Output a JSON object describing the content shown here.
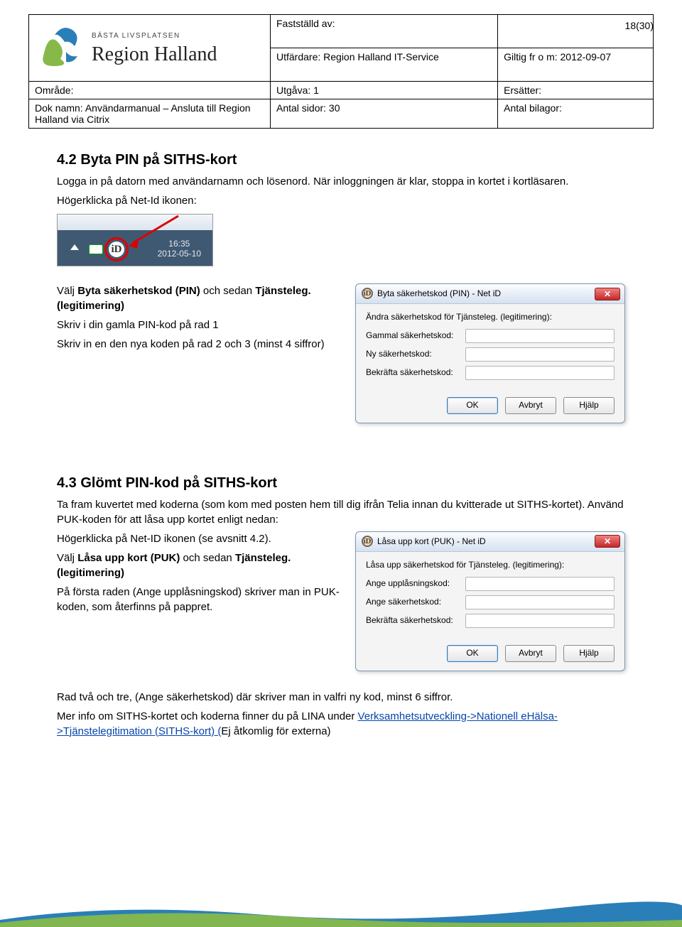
{
  "page_number": "18(30)",
  "header": {
    "logo_tagline": "BÄSTA LIVSPLATSEN",
    "logo_name": "Region Halland",
    "row1_col2_label": "Fastställd av:",
    "row2_col2": "Utfärdare: Region Halland IT-Service",
    "row2_col3": "Giltig fr o m: 2012-09-07",
    "row3_col1": "Område:",
    "row3_col2": "Utgåva: 1",
    "row3_col3": "Ersätter:",
    "row4_col1": "Dok namn: Användarmanual – Ansluta till Region Halland via Citrix",
    "row4_col2": "Antal sidor: 30",
    "row4_col3": "Antal bilagor:"
  },
  "s42": {
    "heading": "4.2 Byta PIN på SITHS-kort",
    "p1": "Logga in på datorn med användarnamn och lösenord. När inloggningen är klar, stoppa in kortet i kortläsaren.",
    "p2": "Högerklicka på Net-Id ikonen:",
    "p3_pre": "Välj ",
    "p3_b1": "Byta säkerhetskod (PIN)",
    "p3_mid": " och sedan ",
    "p3_b2": "Tjänsteleg. (legitimering)",
    "p4": "Skriv i din gamla PIN-kod på rad 1",
    "p5": "Skriv in en den nya koden på rad 2 och 3 (minst 4 siffror)"
  },
  "tray": {
    "netid_glyph": "iD",
    "time": "16:35",
    "date": "2012-05-10"
  },
  "dlg1": {
    "title": "Byta säkerhetskod (PIN) - Net iD",
    "subtitle": "Ändra säkerhetskod för Tjänsteleg. (legitimering):",
    "l1": "Gammal säkerhetskod:",
    "l2": "Ny säkerhetskod:",
    "l3": "Bekräfta säkerhetskod:",
    "ok": "OK",
    "cancel": "Avbryt",
    "help": "Hjälp"
  },
  "s43": {
    "heading": "4.3 Glömt PIN-kod på SITHS-kort",
    "p1": "Ta fram kuvertet med koderna (som kom med posten hem till dig ifrån Telia innan du kvitterade ut SITHS-kortet). Använd PUK-koden för att låsa upp kortet enligt nedan:",
    "p2": "Högerklicka på Net-ID ikonen (se avsnitt 4.2).",
    "p3_pre": "Välj ",
    "p3_b1": "Låsa upp kort (PUK)",
    "p3_mid": " och sedan ",
    "p3_b2": "Tjänsteleg. (legitimering)",
    "p4": "På första raden (Ange upplåsningskod) skriver man in PUK-koden, som återfinns på pappret.",
    "p5": "Rad två och tre, (Ange säkerhetskod) där skriver man in valfri ny kod, minst 6 siffror.",
    "p6_pre": "Mer info om SITHS-kortet och koderna finner du på LINA under ",
    "p6_link": "Verksamhetsutveckling->Nationell eHälsa->Tjänstelegitimation (SITHS-kort) (",
    "p6_post": "Ej åtkomlig för externa)"
  },
  "dlg2": {
    "title": "Låsa upp kort (PUK) - Net iD",
    "subtitle": "Låsa upp säkerhetskod för Tjänsteleg. (legitimering):",
    "l1": "Ange upplåsningskod:",
    "l2": "Ange säkerhetskod:",
    "l3": "Bekräfta säkerhetskod:",
    "ok": "OK",
    "cancel": "Avbryt",
    "help": "Hjälp"
  }
}
